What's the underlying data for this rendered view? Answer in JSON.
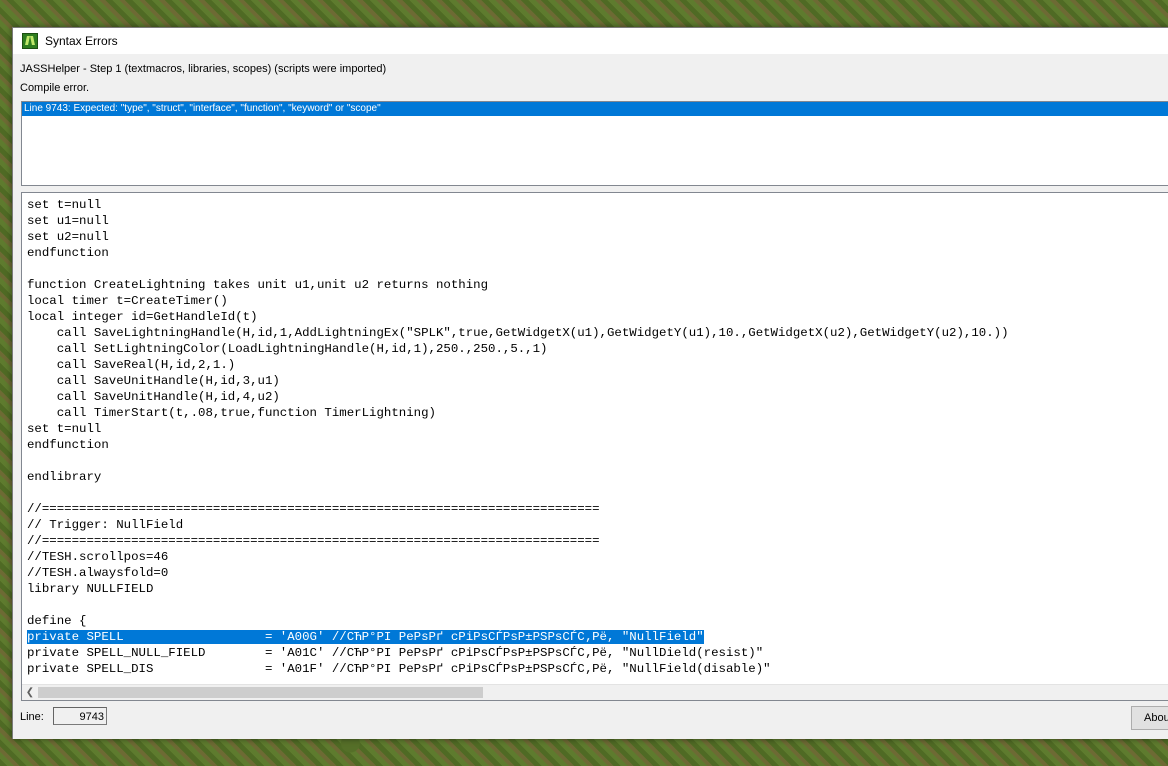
{
  "window": {
    "title": "Syntax Errors",
    "status_step": "JASSHelper - Step 1 (textmacros, libraries, scopes) (scripts were imported)",
    "status_result": "Compile error."
  },
  "errors": [
    "Line 9743: Expected: \"type\", \"struct\", \"interface\", \"function\", \"keyword\" or \"scope\""
  ],
  "code_lines": [
    "set t=null",
    "set u1=null",
    "set u2=null",
    "endfunction",
    "",
    "function CreateLightning takes unit u1,unit u2 returns nothing",
    "local timer t=CreateTimer()",
    "local integer id=GetHandleId(t)",
    "    call SaveLightningHandle(H,id,1,AddLightningEx(\"SPLK\",true,GetWidgetX(u1),GetWidgetY(u1),10.,GetWidgetX(u2),GetWidgetY(u2),10.))",
    "    call SetLightningColor(LoadLightningHandle(H,id,1),250.,250.,5.,1)",
    "    call SaveReal(H,id,2,1.)",
    "    call SaveUnitHandle(H,id,3,u1)",
    "    call SaveUnitHandle(H,id,4,u2)",
    "    call TimerStart(t,.08,true,function TimerLightning)",
    "set t=null",
    "endfunction",
    "",
    "endlibrary",
    "",
    "//===========================================================================",
    "// Trigger: NullField",
    "//===========================================================================",
    "//TESH.scrollpos=46",
    "//TESH.alwaysfold=0",
    "library NULLFIELD",
    "",
    "define {",
    "private SPELL                   = 'A00G' //СЋР°РІ РеРѕРґ сРіРѕСЃРѕР±РЅРѕСЃС‚Рё, \"NullField\"",
    "private SPELL_NULL_FIELD        = 'A01C' //СЋР°РІ РеРѕРґ сРіРѕСЃРѕР±РЅРѕСЃС‚Рё, \"NullDield(resist)\"",
    "private SPELL_DIS               = 'A01F' //СЋР°РІ РеРѕРґ сРіРѕСЃРѕР±РЅРѕСЃС‚Рё, \"NullField(disable)\""
  ],
  "selected_line_index": 27,
  "footer": {
    "line_label": "Line:",
    "line_value": "9743",
    "about_label": "About"
  },
  "colors": {
    "selection": "#0078d7",
    "window_bg": "#f0f0f0"
  }
}
